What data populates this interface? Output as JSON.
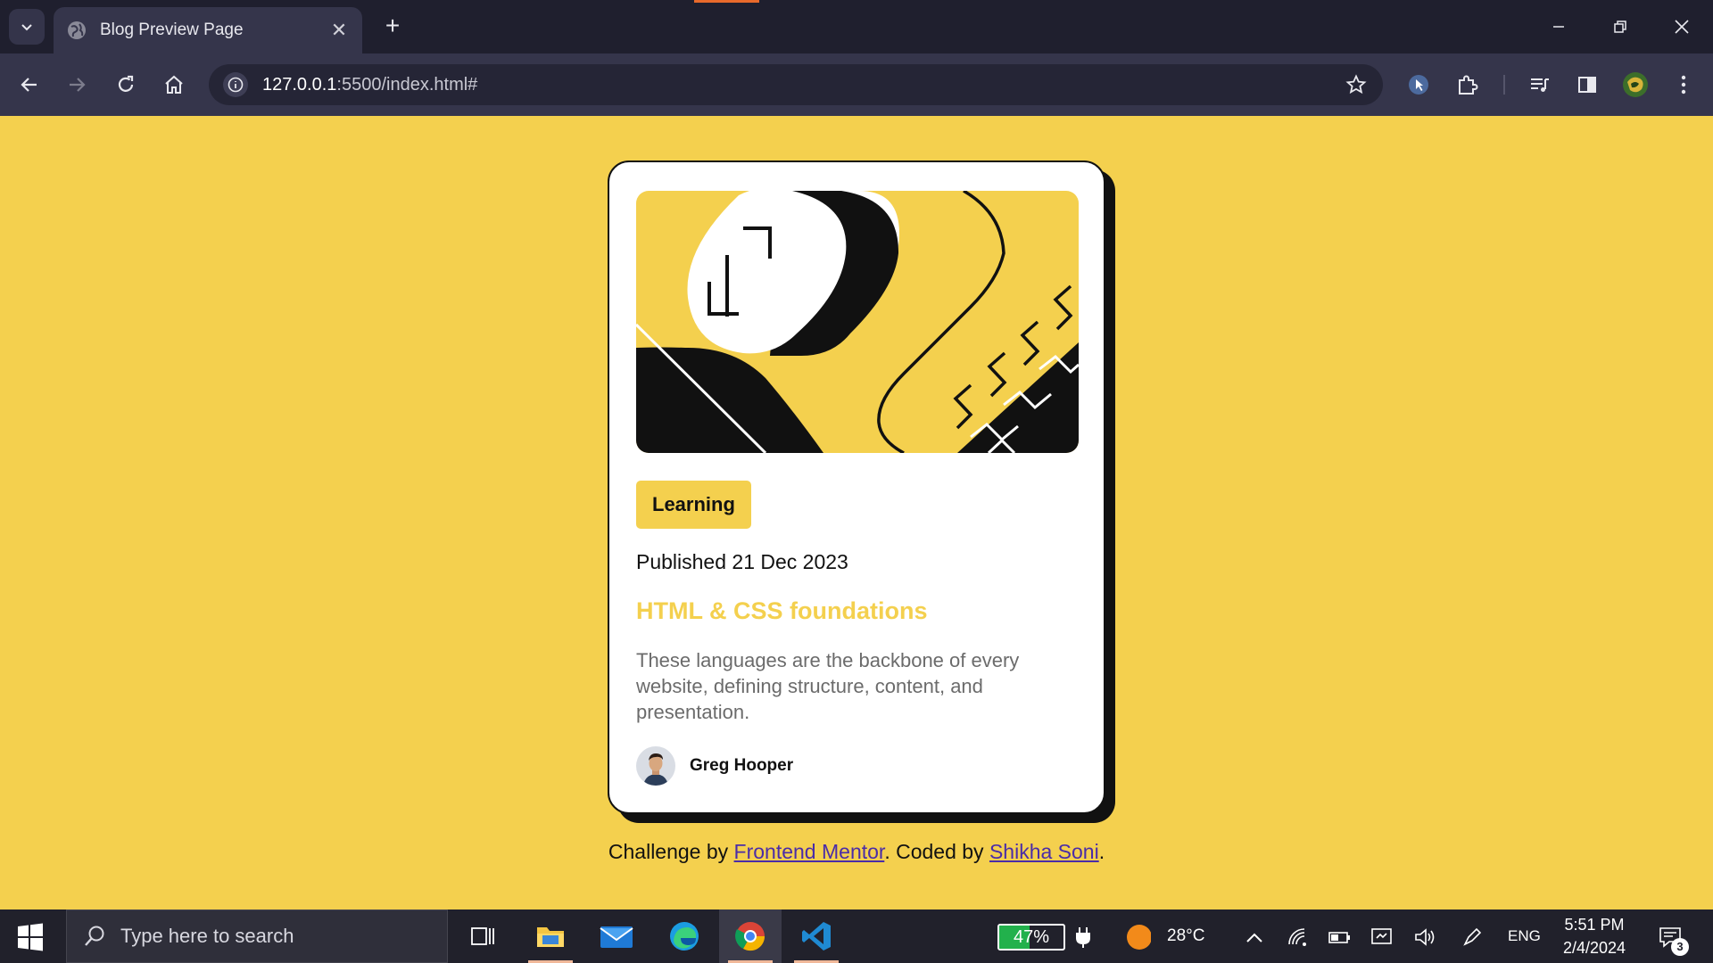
{
  "browser": {
    "tab_title": "Blog Preview Page",
    "url_host": "127.0.0.1",
    "url_rest": ":5500/index.html#"
  },
  "card": {
    "tag": "Learning",
    "published": "Published 21 Dec 2023",
    "title": "HTML & CSS foundations",
    "description": "These languages are the backbone of every website, defining structure, content, and presentation.",
    "author": "Greg Hooper"
  },
  "attribution": {
    "prefix": "Challenge by ",
    "link1": "Frontend Mentor",
    "middle": ". Coded by ",
    "link2": "Shikha Soni",
    "suffix": "."
  },
  "taskbar": {
    "search_placeholder": "Type here to search",
    "battery_percent": 47,
    "battery_label": "47%",
    "weather": "28°C",
    "language": "ENG",
    "time": "5:51 PM",
    "date": "2/4/2024",
    "notifications": "3"
  },
  "colors": {
    "page_bg": "#f4d04e",
    "accent": "#f4d04e",
    "card_border": "#111111"
  }
}
